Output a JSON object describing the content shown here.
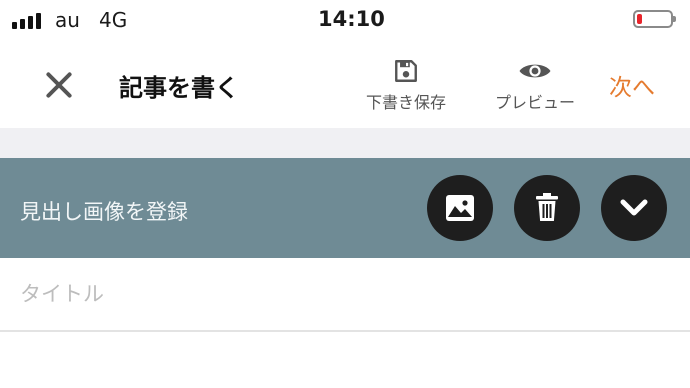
{
  "status_bar": {
    "carrier": "au",
    "network": "4G",
    "time": "14:10",
    "battery_level": 0.15,
    "battery_color": "#e8242b"
  },
  "header": {
    "close_icon": "close-icon",
    "title": "記事を書く",
    "save_draft": {
      "icon": "floppy-disk-icon",
      "label": "下書き保存"
    },
    "preview": {
      "icon": "eye-icon",
      "label": "プレビュー"
    },
    "next_label": "次へ",
    "accent_color": "#e57b2f"
  },
  "cover": {
    "label": "見出し画像を登録",
    "background": "#6f8b95",
    "buttons": [
      {
        "icon": "image-icon",
        "name": "add-image"
      },
      {
        "icon": "trash-icon",
        "name": "delete"
      },
      {
        "icon": "chevron-down-icon",
        "name": "expand"
      }
    ]
  },
  "title_input": {
    "value": "",
    "placeholder": "タイトル"
  }
}
